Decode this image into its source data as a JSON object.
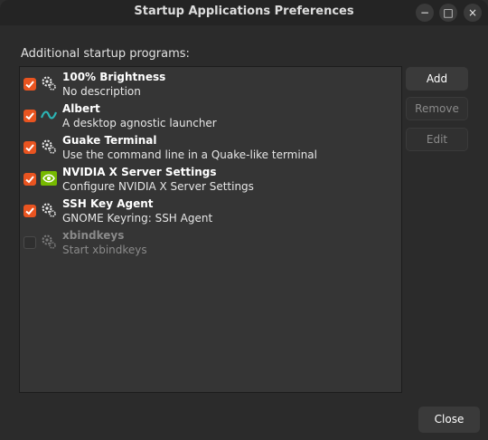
{
  "window": {
    "title": "Startup Applications Preferences",
    "controls": {
      "minimize": "−",
      "maximize": "□",
      "close": "×"
    }
  },
  "section_label": "Additional startup programs:",
  "programs": [
    {
      "name": "100% Brightness",
      "description": "No description",
      "enabled": true,
      "icon": "gear-icon"
    },
    {
      "name": "Albert",
      "description": "A desktop agnostic launcher",
      "enabled": true,
      "icon": "albert-icon"
    },
    {
      "name": "Guake Terminal",
      "description": "Use the command line in a Quake-like terminal",
      "enabled": true,
      "icon": "gear-icon"
    },
    {
      "name": "NVIDIA X Server Settings",
      "description": "Configure NVIDIA X Server Settings",
      "enabled": true,
      "icon": "nvidia-icon"
    },
    {
      "name": "SSH Key Agent",
      "description": "GNOME Keyring: SSH Agent",
      "enabled": true,
      "icon": "gear-icon"
    },
    {
      "name": "xbindkeys",
      "description": "Start xbindkeys",
      "enabled": false,
      "icon": "gear-icon"
    }
  ],
  "buttons": {
    "add": "Add",
    "remove": "Remove",
    "edit": "Edit",
    "close": "Close"
  },
  "colors": {
    "accent": "#e95420",
    "nvidia": "#76b900",
    "albert": "#2cb5b5"
  }
}
